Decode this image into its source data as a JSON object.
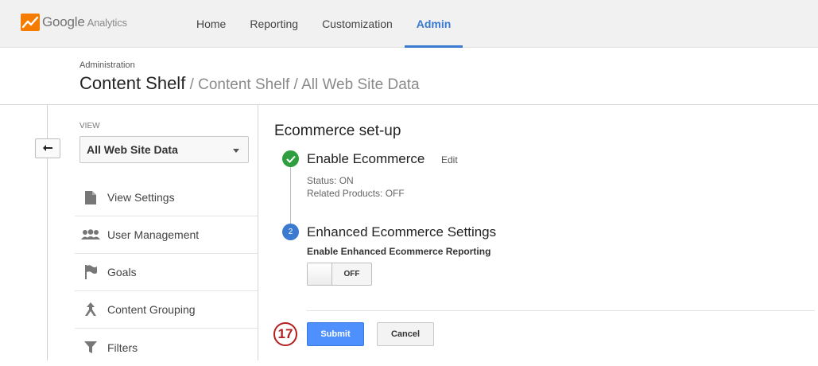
{
  "topbar": {
    "logo_text": "Google",
    "logo_sub": "Analytics",
    "nav": [
      {
        "label": "Home",
        "active": false
      },
      {
        "label": "Reporting",
        "active": false
      },
      {
        "label": "Customization",
        "active": false
      },
      {
        "label": "Admin",
        "active": true
      }
    ]
  },
  "header": {
    "crumb": "Administration",
    "title": "Content Shelf",
    "subtitle": " / Content Shelf / All Web Site Data"
  },
  "sidebar": {
    "view_label": "VIEW",
    "view_selected": "All Web Site Data",
    "items": [
      {
        "label": "View Settings",
        "icon": "document-icon"
      },
      {
        "label": "User Management",
        "icon": "users-icon"
      },
      {
        "label": "Goals",
        "icon": "flag-icon"
      },
      {
        "label": "Content Grouping",
        "icon": "grouping-icon"
      },
      {
        "label": "Filters",
        "icon": "filter-icon"
      }
    ]
  },
  "main": {
    "section_title": "Ecommerce set-up",
    "step1": {
      "title": "Enable Ecommerce",
      "edit": "Edit",
      "status": "Status: ON",
      "related": "Related Products: OFF"
    },
    "step2": {
      "number": "2",
      "title": "Enhanced Ecommerce Settings",
      "label": "Enable Enhanced Ecommerce Reporting",
      "toggle_state": "OFF"
    },
    "annotation": "17",
    "submit": "Submit",
    "cancel": "Cancel"
  },
  "colors": {
    "accent": "#3a7ad0",
    "success": "#2e9e3e",
    "submit": "#4d90fe",
    "annotation": "#b22020"
  }
}
